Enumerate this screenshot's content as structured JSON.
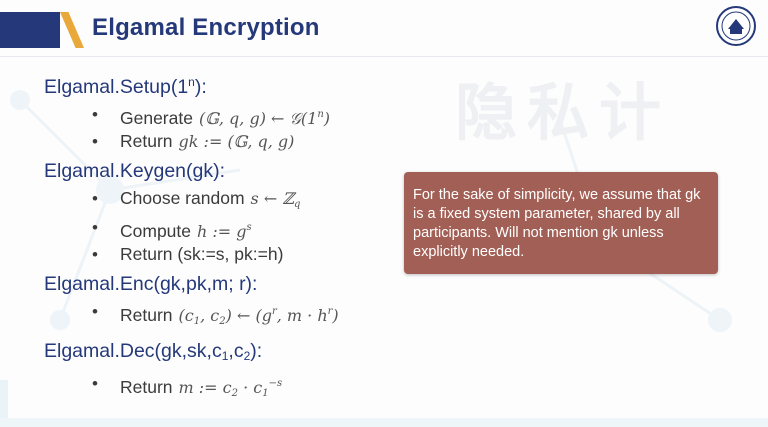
{
  "header": {
    "title": "Elgamal Encryption",
    "logo_icon": "university-seal-icon",
    "accent_color": "#25397a",
    "stripe_color": "#e8a83a"
  },
  "watermark": {
    "text": "隐私计"
  },
  "sections": [
    {
      "head": "Elgamal.Setup(1",
      "head_sup": "n",
      "head_tail": "):",
      "bullets": [
        {
          "label": "Generate",
          "math": "(𝔾, q, g) ← 𝒢(1",
          "math_sup": "n",
          "math_tail": ")"
        },
        {
          "label": "Return",
          "math": "gk := (𝔾, q, g)"
        }
      ]
    },
    {
      "head": "Elgamal.Keygen(gk):",
      "bullets": [
        {
          "label": "Choose random",
          "math": "s ← ℤ",
          "math_sub": "q"
        },
        {
          "label": "Compute",
          "math": "h := g",
          "math_sup": "s"
        },
        {
          "label": "Return (sk:=s, pk:=h)"
        }
      ]
    },
    {
      "head": "Elgamal.Enc(gk,pk,m; r):",
      "bullets": [
        {
          "label": "Return",
          "math": "(c",
          "m1": "1",
          "m2": ", c",
          "m3": "2",
          "m4": ") ← (g",
          "m5": "r",
          "m6": ", m · h",
          "m7": "r",
          "m8": ")"
        }
      ]
    },
    {
      "head": "Elgamal.Dec(gk,sk,c",
      "head_sub1": "1",
      "head_mid": ",c",
      "head_sub2": "2",
      "head_tail": "):",
      "bullets": [
        {
          "label": "Return",
          "math": "m := c",
          "m1": "2",
          "m2": " · c",
          "m3": "1",
          "m4": "−s"
        }
      ]
    }
  ],
  "callout": {
    "text": "For the sake of simplicity, we assume that gk is a fixed system parameter, shared by all participants. Will not mention gk unless explicitly needed.",
    "color": "#a25f55"
  }
}
